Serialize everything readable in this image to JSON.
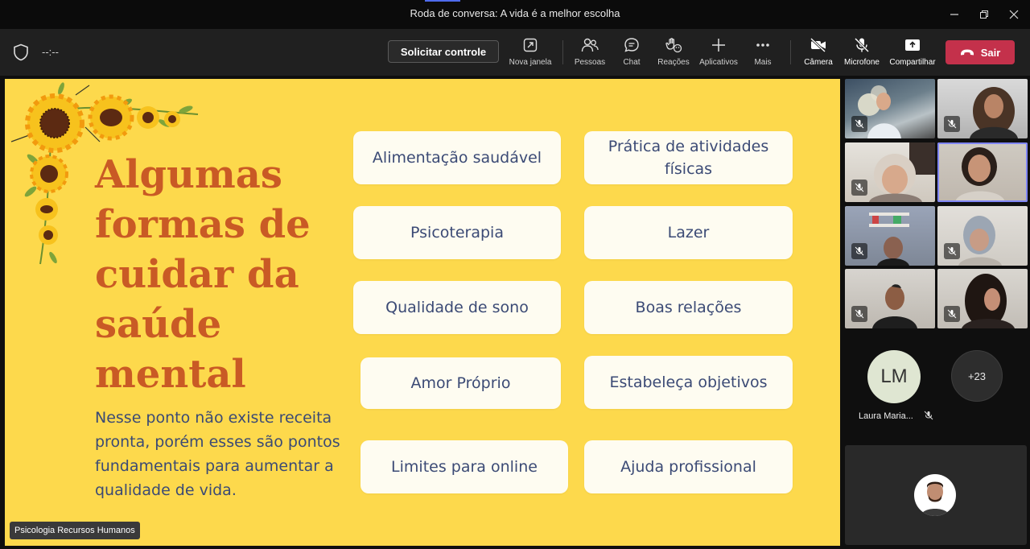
{
  "window": {
    "title": "Roda de conversa: A vida é a melhor escolha"
  },
  "toolbar": {
    "timer": "--:--",
    "request_control": "Solicitar controle",
    "buttons": [
      {
        "label": "Nova janela",
        "icon": "pop-out-icon"
      },
      {
        "label": "Pessoas",
        "icon": "people-icon"
      },
      {
        "label": "Chat",
        "icon": "chat-icon"
      },
      {
        "label": "Reações",
        "icon": "reaction-icon"
      },
      {
        "label": "Aplicativos",
        "icon": "plus-icon"
      },
      {
        "label": "Mais",
        "icon": "more-icon"
      },
      {
        "label": "Câmera",
        "icon": "camera-off-icon"
      },
      {
        "label": "Microfone",
        "icon": "mic-off-icon"
      },
      {
        "label": "Compartilhar",
        "icon": "share-icon"
      }
    ],
    "leave": "Sair",
    "leave_color": "#c4314b"
  },
  "slide": {
    "title": "Algumas\nformas de\ncuidar da\nsaúde\nmental",
    "description": "Nesse ponto não existe receita pronta, porém esses são pontos fundamentais para aumentar a qualidade de vida.",
    "cards": [
      "Alimentação saudável",
      "Prática de atividades físicas",
      "Psicoterapia",
      "Lazer",
      "Qualidade de sono",
      "Boas relações",
      "Amor Próprio",
      "Estabeleça objetivos",
      "Limites para online",
      "Ajuda profissional"
    ],
    "background": "#fdd94c",
    "title_color": "#c95a25",
    "text_color": "#3b4a75"
  },
  "presenter_caption": "Psicologia Recursos Humanos",
  "participants": {
    "lm_initials": "LM",
    "lm_name": "Laura Maria...",
    "more_count": "+23"
  }
}
